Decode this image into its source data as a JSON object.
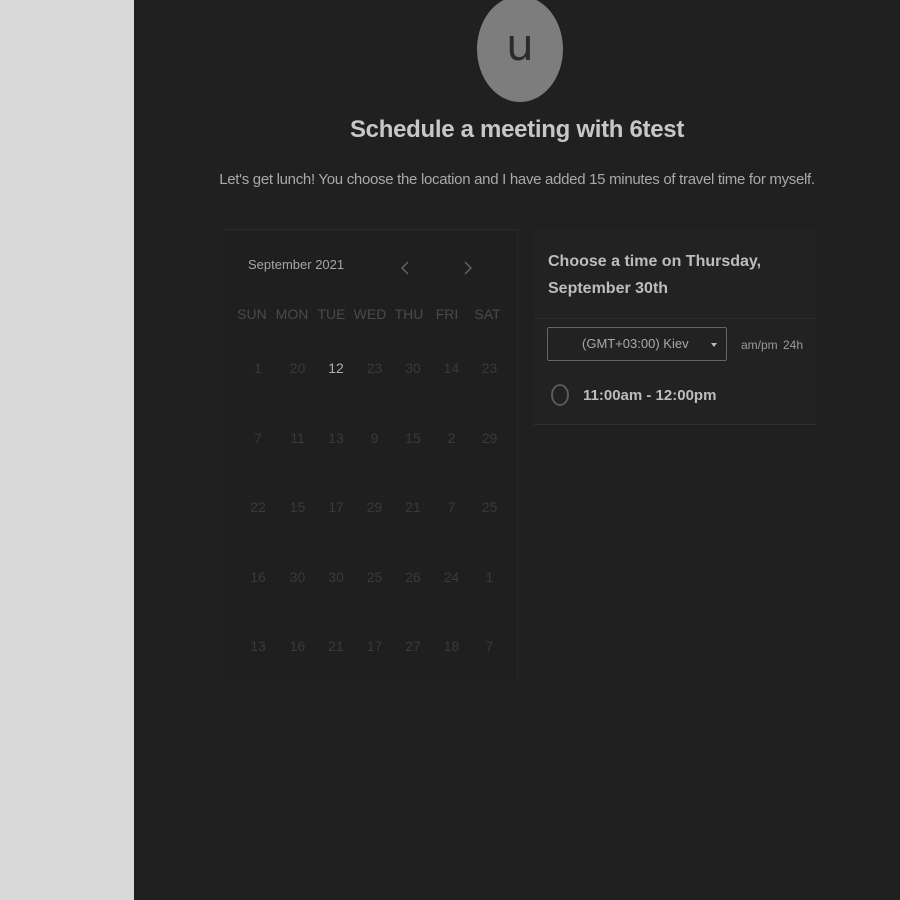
{
  "avatar": {
    "initial": "u"
  },
  "title": "Schedule a meeting with 6test",
  "subtitle": "Let's get lunch! You choose the location and I have added 15 minutes of travel time for myself.",
  "calendar": {
    "month_label": "September 2021",
    "weekdays": [
      "SUN",
      "MON",
      "TUE",
      "WED",
      "THU",
      "FRI",
      "SAT"
    ],
    "weeks": [
      [
        "1",
        "20",
        "12",
        "23",
        "30",
        "14",
        "23"
      ],
      [
        "7",
        "11",
        "13",
        "9",
        "15",
        "2",
        "29"
      ],
      [
        "22",
        "15",
        "17",
        "29",
        "21",
        "7",
        "25"
      ],
      [
        "16",
        "30",
        "30",
        "25",
        "26",
        "24",
        "1"
      ],
      [
        "13",
        "16",
        "21",
        "17",
        "27",
        "18",
        "7"
      ]
    ],
    "active_day": "12"
  },
  "slots_panel": {
    "header": "Choose a time on Thursday, September 30th",
    "timezone": "(GMT+03:00) Kiev",
    "format_ampm": "am/pm",
    "format_24h": "24h",
    "times": [
      "11:00am - 12:00pm"
    ]
  },
  "colors": {
    "background": "#202020",
    "side_strip": "#d9d9d9",
    "avatar": "#7d7d7d"
  }
}
